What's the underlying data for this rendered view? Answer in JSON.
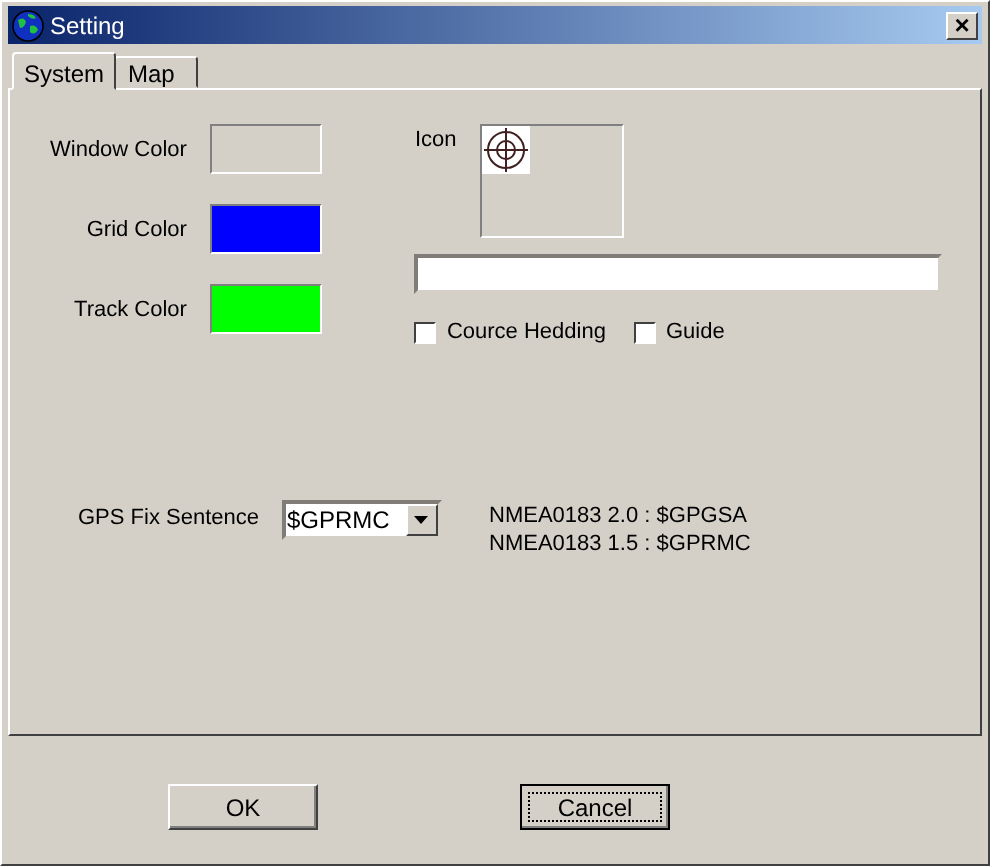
{
  "window": {
    "title": "Setting",
    "close": "×"
  },
  "tabs": [
    {
      "label": "System",
      "selected": true
    },
    {
      "label": "Map",
      "selected": false
    }
  ],
  "colors": [
    {
      "label": "Window Color",
      "color": "#d4d0c8"
    },
    {
      "label": "Grid Color",
      "color": "#0000ff"
    },
    {
      "label": "Track Color",
      "color": "#00ff00"
    }
  ],
  "icon": {
    "label": "Icon"
  },
  "checkboxes": [
    {
      "label": "Cource Hedding",
      "checked": false
    },
    {
      "label": "Guide",
      "checked": false
    }
  ],
  "gps": {
    "label": "GPS Fix Sentence",
    "value": "$GPRMC",
    "notes": [
      "NMEA0183 2.0 : $GPGSA",
      "NMEA0183 1.5 : $GPRMC"
    ]
  },
  "buttons": [
    {
      "label": "OK",
      "focused": false
    },
    {
      "label": "Cancel",
      "focused": true
    }
  ]
}
